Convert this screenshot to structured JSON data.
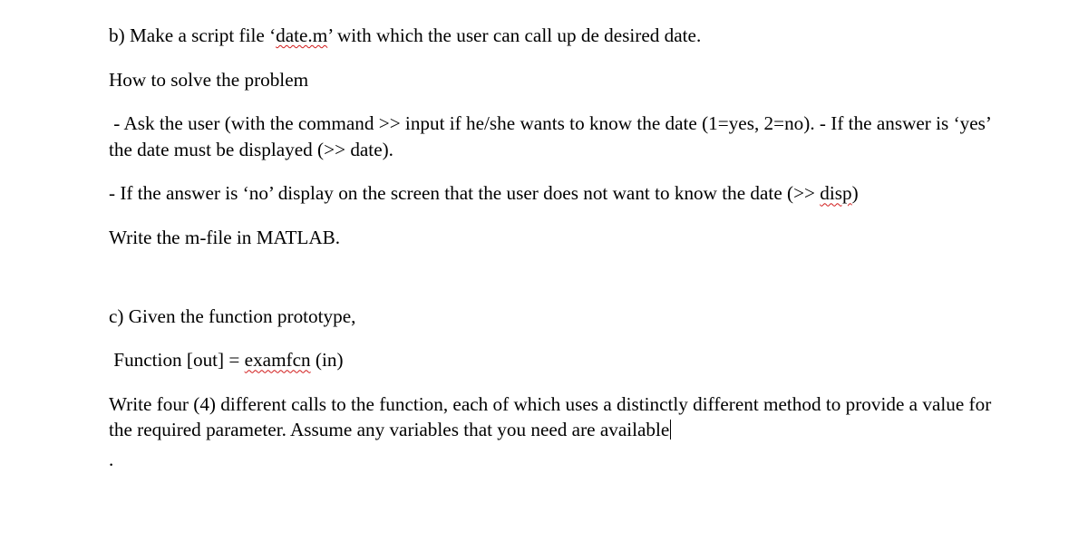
{
  "b": {
    "line1_pre": "b) Make a script file ‘",
    "line1_spell": "date.m",
    "line1_post": "’ with which the user can call up de desired date.",
    "line2": "How to solve the problem",
    "line3": " - Ask the user (with the command >> input if he/she wants to know the date (1=yes, 2=no). - If the answer is ‘yes’ the date must be displayed (>> date).",
    "line4_pre": "- If the answer is ‘no’ display on the screen that the user does not want to know the date (>> ",
    "line4_spell": "disp",
    "line4_post": ")",
    "line5": "Write the m-file in MATLAB."
  },
  "c": {
    "line1": "c) Given the function prototype,",
    "line2_pre": " Function [out] = ",
    "line2_spell": "examfcn",
    "line2_post": " (in)",
    "line3": "Write four (4) different calls to the function, each of which uses a distinctly different method to provide a value for the required parameter. Assume any variables that you need are available",
    "dot": "."
  }
}
